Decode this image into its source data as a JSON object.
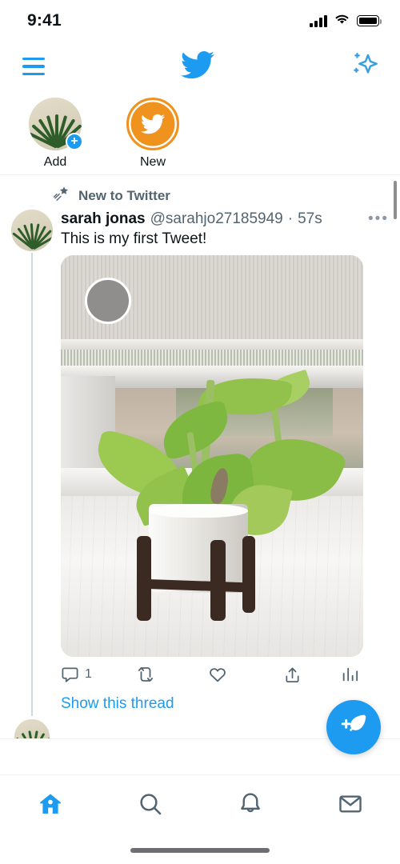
{
  "status_bar": {
    "time": "9:41",
    "signal_icon": "signal-bars-icon",
    "wifi_icon": "wifi-icon",
    "battery_icon": "battery-full-icon"
  },
  "nav_bar": {
    "menu_icon": "hamburger-menu-icon",
    "logo_icon": "twitter-bird-logo",
    "sparkle_icon": "sparkle-timeline-settings-icon"
  },
  "fleets": {
    "items": [
      {
        "label": "Add",
        "type": "add-fleet",
        "badge": "+",
        "avatar_icon": "user-avatar-plant"
      },
      {
        "label": "New",
        "type": "new-fleet",
        "icon": "twitter-bird-icon"
      }
    ]
  },
  "timeline": {
    "social_context": {
      "icon": "shooting-star-icon",
      "label": "New to Twitter"
    },
    "tweet": {
      "avatar_icon": "avatar-sarah-jonas",
      "name": "sarah jonas",
      "handle": "@sarahjo27185949",
      "separator": "·",
      "timestamp": "57s",
      "more_icon": "more-options-icon",
      "text": "This is my first Tweet!",
      "media": {
        "alt": "potted pothos plant on a windowsill in a wooden stand",
        "tag_icon": "photo-tag-circle"
      },
      "actions": [
        {
          "name": "reply",
          "icon": "reply-icon",
          "count": "1"
        },
        {
          "name": "retweet",
          "icon": "retweet-icon",
          "count": ""
        },
        {
          "name": "like",
          "icon": "heart-icon",
          "count": ""
        },
        {
          "name": "share",
          "icon": "share-icon",
          "count": ""
        },
        {
          "name": "analytics",
          "icon": "analytics-bars-icon",
          "count": ""
        }
      ],
      "show_thread_label": "Show this thread"
    },
    "next_avatar_icon": "avatar-sarah-jonas-small"
  },
  "compose": {
    "icon": "compose-tweet-feather-icon",
    "label": "Tweet"
  },
  "tab_bar": {
    "tabs": [
      {
        "name": "home",
        "icon": "home-icon",
        "active": true
      },
      {
        "name": "search",
        "icon": "search-icon",
        "active": false
      },
      {
        "name": "notifications",
        "icon": "bell-icon",
        "active": false
      },
      {
        "name": "messages",
        "icon": "envelope-icon",
        "active": false
      }
    ],
    "home_indicator": "home-indicator-bar"
  },
  "colors": {
    "twitter_blue": "#1d9bf0",
    "fleet_orange": "#f0931e",
    "text_primary": "#0f1419",
    "text_secondary": "#536471",
    "divider": "#eff3f4"
  }
}
